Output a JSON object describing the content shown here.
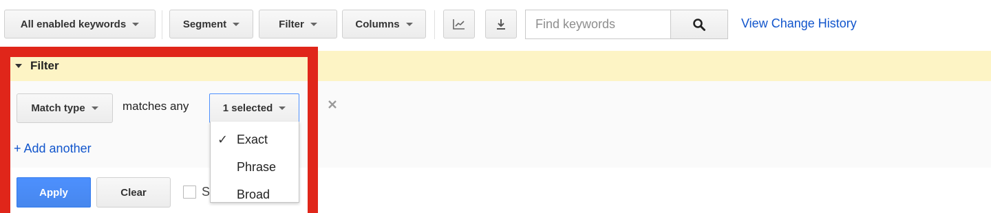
{
  "toolbar": {
    "keywords_filter": "All enabled keywords",
    "segment": "Segment",
    "filter": "Filter",
    "columns": "Columns",
    "chart_icon": "line-chart-icon",
    "download_icon": "download-icon",
    "search_placeholder": "Find keywords",
    "search_icon": "magnifier-icon",
    "change_history_link": "View Change History"
  },
  "filter_panel": {
    "title": "Filter",
    "condition": {
      "field": "Match type",
      "operator": "matches any",
      "value": "1 selected"
    },
    "remove_icon": "close-icon",
    "add_another": "+ Add another",
    "apply": "Apply",
    "clear": "Clear",
    "save_checkbox_label_visible": "S",
    "dropdown_options": [
      {
        "label": "Exact",
        "selected": true
      },
      {
        "label": "Phrase",
        "selected": false
      },
      {
        "label": "Broad",
        "selected": false
      }
    ]
  },
  "colors": {
    "filter_band": "#fdf4c5",
    "highlight_border": "#e0261a",
    "apply_button": "#4d90fe",
    "link": "#1155cc"
  }
}
